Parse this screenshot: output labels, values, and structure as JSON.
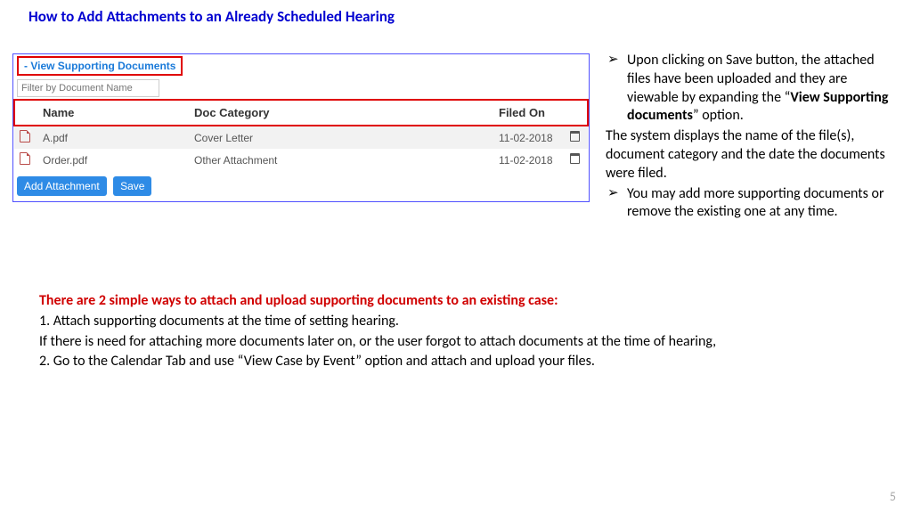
{
  "title": "How to Add Attachments to an Already Scheduled Hearing",
  "panel": {
    "vsd_label": "- View Supporting Documents",
    "filter_placeholder": "Filter by Document Name",
    "columns": {
      "name": "Name",
      "cat": "Doc Category",
      "filed": "Filed On"
    },
    "rows": [
      {
        "name": "A.pdf",
        "cat": "Cover Letter",
        "filed": "11-02-2018"
      },
      {
        "name": "Order.pdf",
        "cat": "Other Attachment",
        "filed": "11-02-2018"
      }
    ],
    "buttons": {
      "add": "Add Attachment",
      "save": "Save"
    }
  },
  "right": {
    "b1_pre": "Upon clicking on Save button, the attached files have been uploaded and they are viewable by expanding the “",
    "b1_bold": "View Supporting documents",
    "b1_post": "” option.",
    "p1": "The system displays the name of the file(s), document category and the date the documents were filed.",
    "b2": "You may add more supporting documents or remove the existing one at any time."
  },
  "lower": {
    "red": "There are 2 simple ways to attach and upload supporting documents to an existing case:",
    "l1": "1.   Attach supporting documents at the time of setting hearing.",
    "l2": "If there is need for attaching more documents later on, or the user forgot to attach documents at the time of hearing,",
    "l3": "2. Go to the Calendar Tab and use “View Case by Event” option and attach and upload your files."
  },
  "page_number": "5"
}
